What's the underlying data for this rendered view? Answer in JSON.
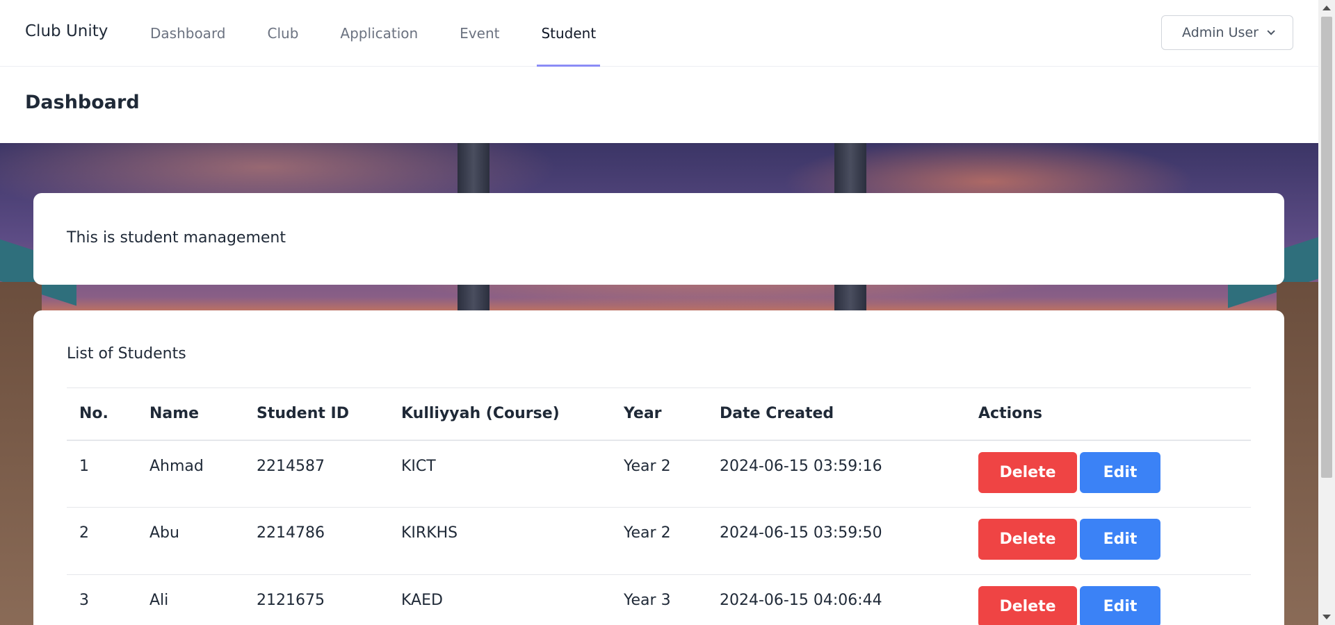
{
  "brand": "Club Unity",
  "nav": {
    "items": [
      {
        "label": "Dashboard",
        "active": false
      },
      {
        "label": "Club",
        "active": false
      },
      {
        "label": "Application",
        "active": false
      },
      {
        "label": "Event",
        "active": false
      },
      {
        "label": "Student",
        "active": true
      }
    ]
  },
  "user_menu": {
    "label": "Admin User",
    "icon": "chevron-down-icon"
  },
  "header": {
    "title": "Dashboard"
  },
  "intro": {
    "text": "This is student management"
  },
  "students": {
    "title": "List of Students",
    "columns": [
      "No.",
      "Name",
      "Student ID",
      "Kulliyyah (Course)",
      "Year",
      "Date Created",
      "Actions"
    ],
    "rows": [
      {
        "no": "1",
        "name": "Ahmad",
        "student_id": "2214587",
        "kulliyyah": "KICT",
        "year": "Year 2",
        "date_created": "2024-06-15 03:59:16"
      },
      {
        "no": "2",
        "name": "Abu",
        "student_id": "2214786",
        "kulliyyah": "KIRKHS",
        "year": "Year 2",
        "date_created": "2024-06-15 03:59:50"
      },
      {
        "no": "3",
        "name": "Ali",
        "student_id": "2121675",
        "kulliyyah": "KAED",
        "year": "Year 3",
        "date_created": "2024-06-15 04:06:44"
      }
    ],
    "actions": {
      "delete_label": "Delete",
      "edit_label": "Edit"
    }
  },
  "colors": {
    "accent": "#8b8cf6",
    "delete": "#ef4444",
    "edit": "#3b82f6"
  }
}
